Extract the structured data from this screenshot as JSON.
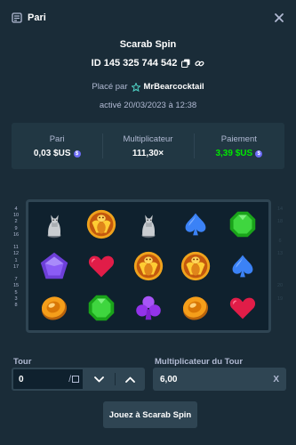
{
  "header": {
    "title": "Pari",
    "icons": {
      "title": "bet-slip-icon",
      "close": "close-icon"
    }
  },
  "bet": {
    "game_name": "Scarab Spin",
    "id_text": "ID 145 325 744 542",
    "placed_by_prefix": "Placé par",
    "username": "MrBearcocktail",
    "activated_text": "activé 20/03/2023 à 12:38"
  },
  "stats": {
    "bet_label": "Pari",
    "bet_value": "0,03 $US",
    "multiplier_label": "Multiplicateur",
    "multiplier_value": "111,30×",
    "payout_label": "Paiement",
    "payout_value": "3,39 $US",
    "payout_color": "#00e701"
  },
  "reels": {
    "paylines_left": [
      "4",
      "10",
      "2",
      "9",
      "16",
      "",
      "11",
      "12",
      "1",
      "17",
      "",
      "7",
      "15",
      "5",
      "3",
      "8"
    ],
    "paylines_right": [
      "14",
      "",
      "18",
      "",
      "",
      "6",
      "",
      "13",
      "",
      "",
      "",
      "",
      "20",
      "",
      "19"
    ],
    "symbols": [
      "cat-statue",
      "golden-scarab",
      "cat-statue",
      "blue-spade",
      "green-gem",
      "purple-pentagon",
      "red-heart",
      "golden-scarab",
      "golden-scarab",
      "blue-spade",
      "gold-coin",
      "green-gem",
      "purple-club",
      "gold-coin",
      "red-heart"
    ]
  },
  "controls": {
    "round_label": "Tour",
    "round_value": "0",
    "round_separator": "/",
    "round_multiplier_label": "Multiplicateur du Tour",
    "round_multiplier_value": "6,00",
    "clear_label": "X",
    "play_button": "Jouez à Scarab Spin"
  }
}
